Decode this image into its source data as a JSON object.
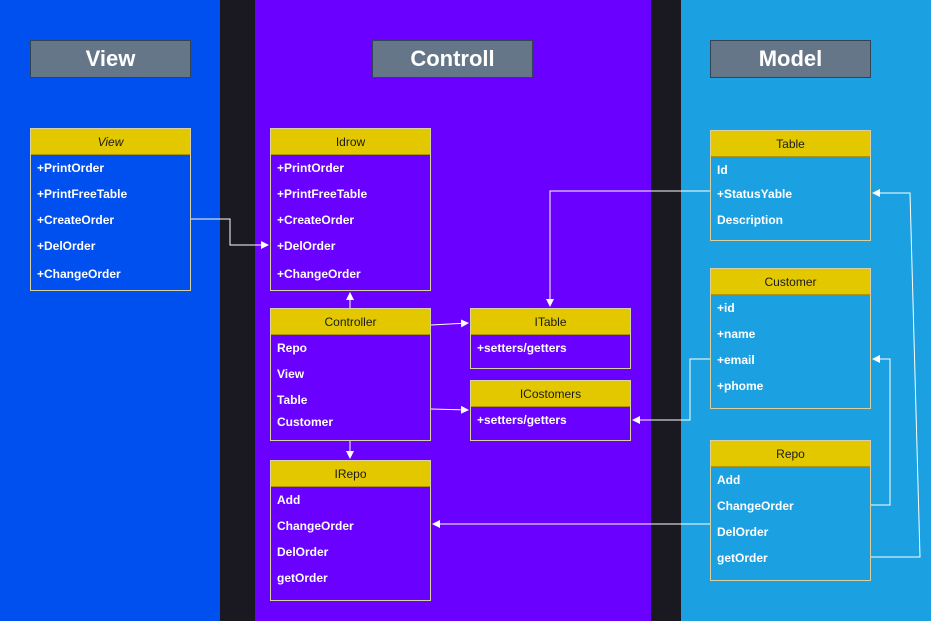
{
  "lanes": {
    "view": "View",
    "controll": "Controll",
    "model": "Model"
  },
  "classes": {
    "view": {
      "name": "View",
      "rows": [
        "+PrintOrder",
        "+PrintFreeTable",
        "+CreateOrder",
        "+DelOrder",
        "+ChangeOrder"
      ]
    },
    "idrow": {
      "name": "Idrow",
      "rows": [
        "+PrintOrder",
        "+PrintFreeTable",
        "+CreateOrder",
        "+DelOrder",
        "+ChangeOrder"
      ]
    },
    "controller": {
      "name": "Controller",
      "rows": [
        "Repo",
        "View",
        "Table",
        "Customer"
      ]
    },
    "itable": {
      "name": "ITable",
      "rows": [
        "+setters/getters"
      ]
    },
    "icostomers": {
      "name": "ICostomers",
      "rows": [
        "+setters/getters"
      ]
    },
    "irepo": {
      "name": "IRepo",
      "rows": [
        "Add",
        "ChangeOrder",
        "DelOrder",
        "getOrder"
      ]
    },
    "table": {
      "name": "Table",
      "rows": [
        "Id",
        "+StatusYable",
        "Description"
      ]
    },
    "customer": {
      "name": "Customer",
      "rows": [
        "+id",
        "+name",
        "+email",
        "+phome"
      ]
    },
    "repo": {
      "name": "Repo",
      "rows": [
        "Add",
        "ChangeOrder",
        "DelOrder",
        "getOrder"
      ]
    }
  },
  "colors": {
    "view_lane": "#0050ef",
    "controll_lane": "#6a00ff",
    "model_lane": "#1ba1e2",
    "class_header": "#e3c800",
    "title_box": "#647687",
    "connector": "#ffffff"
  }
}
